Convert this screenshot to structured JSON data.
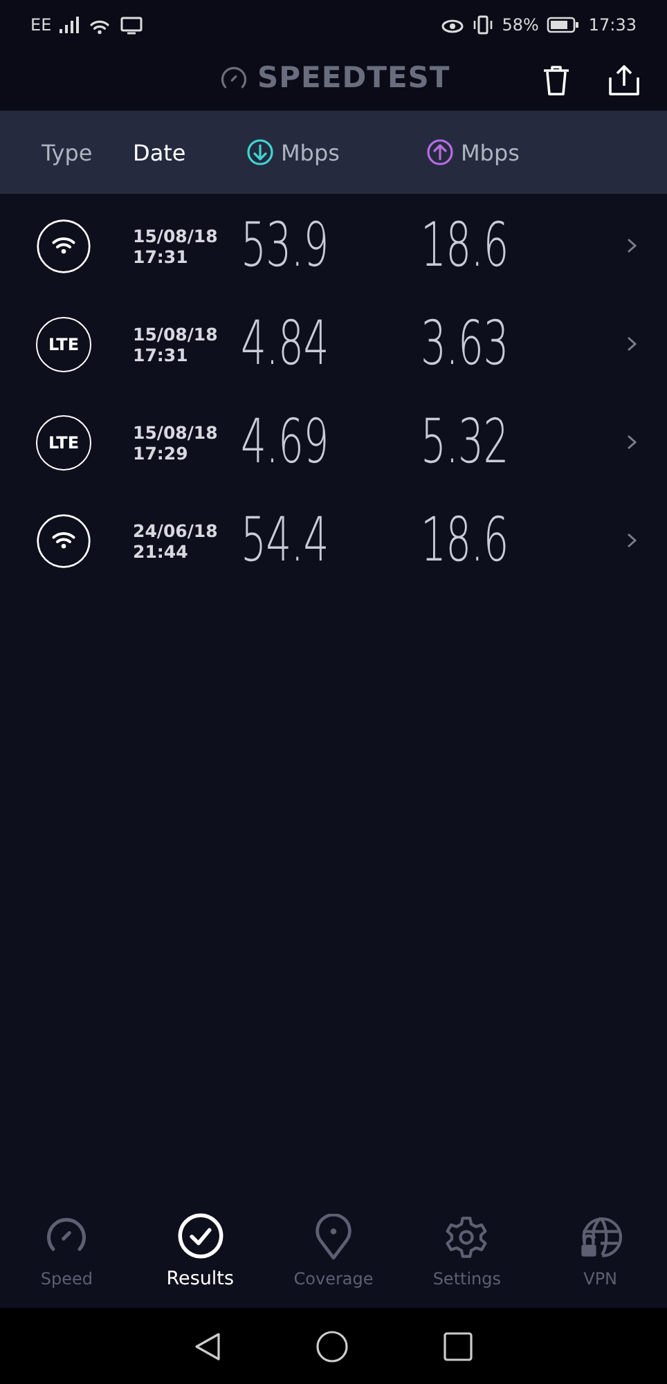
{
  "status_bar": {
    "carrier": "EE",
    "battery": "58%",
    "time": "17:33"
  },
  "header": {
    "title": "SPEEDTEST"
  },
  "columns": [
    {
      "label": "Type",
      "kind": "plain",
      "selected": false
    },
    {
      "label": "Date",
      "kind": "plain",
      "selected": true
    },
    {
      "label": "Mbps",
      "kind": "download",
      "selected": false
    },
    {
      "label": "Mbps",
      "kind": "upload",
      "selected": false
    }
  ],
  "rows": [
    {
      "kind": "wifi",
      "date": "15/08/18",
      "time": "17:31",
      "download": "53.9",
      "upload": "18.6"
    },
    {
      "kind": "lte",
      "badge": "LTE",
      "date": "15/08/18",
      "time": "17:31",
      "download": "4.84",
      "upload": "3.63"
    },
    {
      "kind": "lte",
      "badge": "LTE",
      "date": "15/08/18",
      "time": "17:29",
      "download": "4.69",
      "upload": "5.32"
    },
    {
      "kind": "wifi",
      "date": "24/06/18",
      "time": "21:44",
      "download": "54.4",
      "upload": "18.6"
    }
  ],
  "nav": [
    {
      "kind": "speed",
      "label": "Speed",
      "selected": false
    },
    {
      "kind": "results",
      "label": "Results",
      "selected": true
    },
    {
      "kind": "coverage",
      "label": "Coverage",
      "selected": false
    },
    {
      "kind": "settings",
      "label": "Settings",
      "selected": false
    },
    {
      "kind": "vpn",
      "label": "VPN",
      "selected": false
    }
  ]
}
